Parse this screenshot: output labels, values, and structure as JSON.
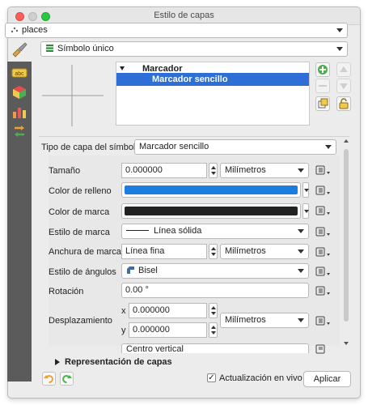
{
  "window": {
    "title": "Estilo de capas"
  },
  "layer_selector": {
    "value": "places"
  },
  "renderer_selector": {
    "value": "Símbolo único"
  },
  "symbol_tree": {
    "root": "Marcador",
    "child": "Marcador sencillo"
  },
  "form": {
    "symbol_layer_type_label": "Tipo de capa del símbolo",
    "symbol_layer_type_value": "Marcador sencillo",
    "size_label": "Tamaño",
    "size_value": "0.000000",
    "size_unit": "Milímetros",
    "fill_color_label": "Color de relleno",
    "fill_color": "#1a7de0",
    "stroke_color_label": "Color de marca",
    "stroke_color": "#222222",
    "stroke_style_label": "Estilo de marca",
    "stroke_style_value": "Línea sólida",
    "stroke_width_label": "Anchura de marca",
    "stroke_width_value": "Línea fina",
    "stroke_width_unit": "Milímetros",
    "join_style_label": "Estilo de ángulos",
    "join_style_value": "Bisel",
    "rotation_label": "Rotación",
    "rotation_value": "0.00 °",
    "offset_label": "Desplazamiento",
    "offset_x_label": "x",
    "offset_x_value": "0.000000",
    "offset_y_label": "y",
    "offset_y_value": "0.000000",
    "offset_unit": "Milímetros",
    "anchor_value": "Centro vertical"
  },
  "layer_rendering_label": "Representación de capas",
  "live_update_label": "Actualización en vivo",
  "apply_label": "Aplicar",
  "colors": {
    "selection": "#2d6fd6",
    "sidebar": "#5b5b5b"
  }
}
